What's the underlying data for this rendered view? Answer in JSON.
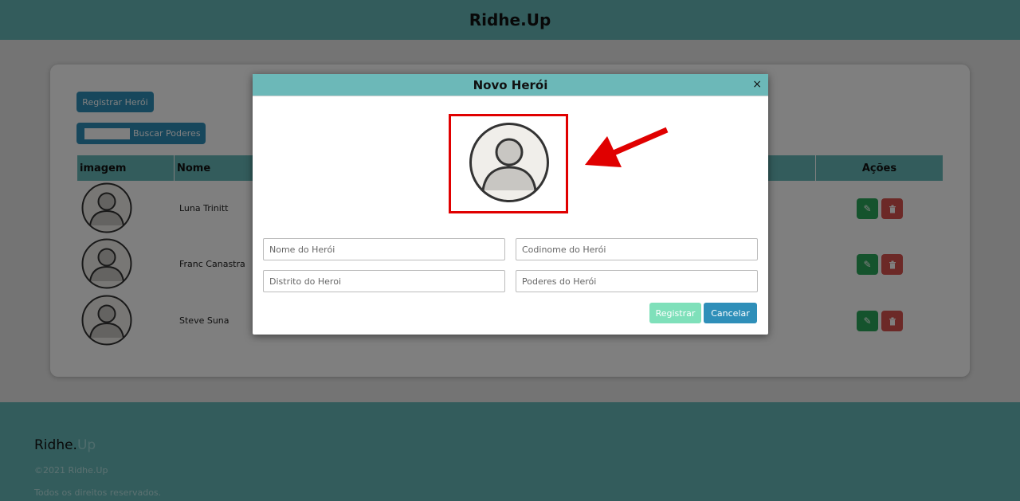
{
  "header": {
    "brand": "Ridhe.Up"
  },
  "main": {
    "register_button": "Registrar Herói",
    "search_label": "Buscar Poderes",
    "table": {
      "headers": [
        "imagem",
        "Nome",
        "Ações"
      ],
      "rows": [
        {
          "name": "Luna Trinitt"
        },
        {
          "name": "Franc Canastra"
        },
        {
          "name": "Steve Suna"
        }
      ]
    }
  },
  "footer": {
    "brand_main": "Ridhe.",
    "brand_accent": "Up",
    "copyright": "©2021 Ridhe.Up",
    "rights": "Todos os direitos reservados."
  },
  "modal": {
    "title": "Novo Herói",
    "close": "×",
    "fields": {
      "name_placeholder": "Nome do Herói",
      "codename_placeholder": "Codinome do Herói",
      "district_placeholder": "Distrito do Heroi",
      "powers_placeholder": "Poderes do Herói"
    },
    "submit_label": "Registrar",
    "cancel_label": "Cancelar"
  },
  "colors": {
    "teal": "#66b9b9",
    "primary": "#2f8fb9",
    "success": "#2aa65a",
    "danger": "#d9534f",
    "highlight": "#e00000"
  }
}
